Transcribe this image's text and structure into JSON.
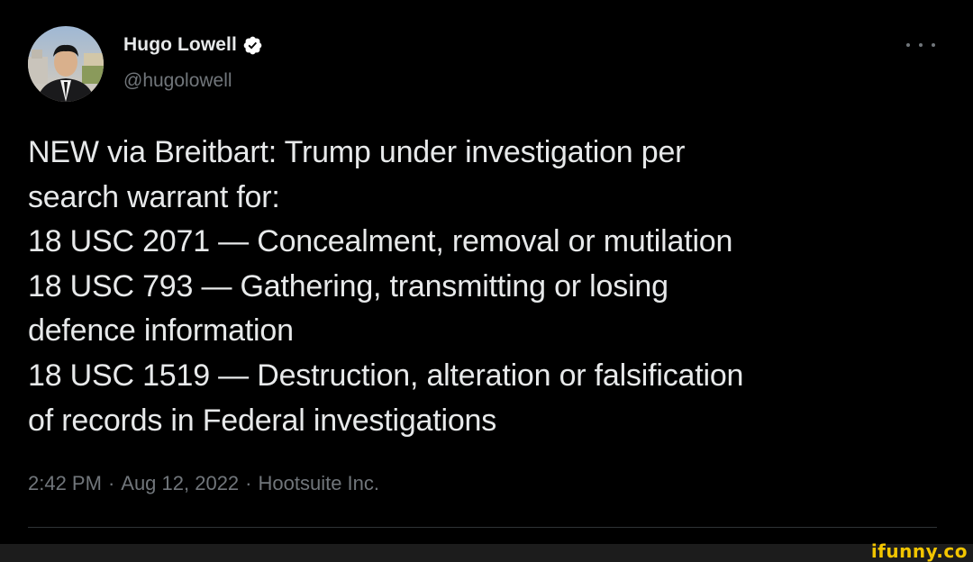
{
  "tweet": {
    "author": {
      "display_name": "Hugo Lowell",
      "handle": "@hugolowell",
      "verified": true,
      "avatar": "avatar-photo"
    },
    "more_icon": "more-horizontal-icon",
    "lines": [
      "NEW via Breitbart: Trump under investigation per",
      "search warrant for:",
      "18 USC 2071 — Concealment, removal or mutilation",
      "18 USC 793 — Gathering, transmitting or losing",
      "defence information",
      "18 USC 1519 — Destruction, alteration or falsification",
      "of records in Federal investigations"
    ],
    "meta": {
      "time": "2:42 PM",
      "separator": "·",
      "date": "Aug 12, 2022",
      "source": "Hootsuite Inc."
    }
  },
  "watermark": {
    "text": "ifunny.co",
    "color": "#f2c500"
  },
  "colors": {
    "background": "#000000",
    "text_primary": "#e7e9ea",
    "text_secondary": "#71767b",
    "verified_badge": "#ffffff",
    "divider": "#2f3336"
  }
}
